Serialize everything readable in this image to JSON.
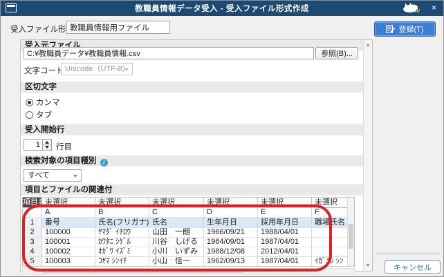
{
  "title_bar": {
    "title": "教職員情報データ受入 - 受入ファイル形式作成",
    "logo_text": "AI",
    "close_glyph": "×"
  },
  "header": {
    "format_name_label": "受入ファイル形式名",
    "format_name_value": "教職員情報用ファイル",
    "register_button_label": "登録(T)"
  },
  "source_file": {
    "section_title": "受入元ファイル",
    "file_path": "C:¥教職員データ¥教職員情報.csv",
    "browse_button_label": "参照(B)...",
    "encoding_label": "文字コード",
    "encoding_value": "Unicode（UTF-8）"
  },
  "delimiter": {
    "section_title": "区切文字",
    "options": [
      {
        "label": "カンマ",
        "selected": true
      },
      {
        "label": "タブ",
        "selected": false
      }
    ]
  },
  "start_row": {
    "section_title": "受入開始行",
    "value": "1",
    "suffix": "行目"
  },
  "item_type": {
    "section_title": "検索対象の項目種別",
    "info_icon_glyph": "i",
    "value": "すべて"
  },
  "mapping": {
    "section_title": "項目とファイルの関連付",
    "corner_header": "項目名",
    "column_headers": [
      "未選択",
      "未選択",
      "未選択",
      "未選択",
      "未選択",
      "未選択"
    ],
    "column_letters": [
      "A",
      "B",
      "C",
      "D",
      "E",
      "F"
    ],
    "rows": [
      {
        "num": "1",
        "highlight": true,
        "cells": [
          "番号",
          "氏名(フリガナ)",
          "氏名",
          "生年月日",
          "採用年月日",
          "職場氏名"
        ]
      },
      {
        "num": "2",
        "highlight": false,
        "cells": [
          "100000",
          "ﾔﾏﾀﾞ ｲﾁﾛｳ",
          "山田　一朗",
          "1966/09/21",
          "1988/04/01",
          ""
        ]
      },
      {
        "num": "3",
        "highlight": false,
        "cells": [
          "100001",
          "ｶﾜﾀﾆ ｼｹﾞﾙ",
          "川谷　しげる",
          "1964/09/01",
          "1987/04/01",
          ""
        ]
      },
      {
        "num": "4",
        "highlight": false,
        "cells": [
          "100002",
          "ｵｶﾞﾜ ｲｽﾞﾐ",
          "小川　いずみ",
          "1988/12/08",
          "2012/04/01",
          ""
        ]
      },
      {
        "num": "5",
        "highlight": false,
        "cells": [
          "100003",
          "ｺﾔﾏ ｼﾝｲﾁ",
          "小山　信一",
          "1962/09/13",
          "1987/04/01",
          "ｲｶﾞﾗｼ ｼﾝ"
        ]
      }
    ]
  },
  "footer": {
    "cancel_button_label": "キャンセル"
  },
  "colors": {
    "titlebar": "#1c4a72",
    "accent_blue": "#3d7cd7",
    "row_highlight": "#d9e9f7",
    "annotation_red": "#dc2127"
  }
}
